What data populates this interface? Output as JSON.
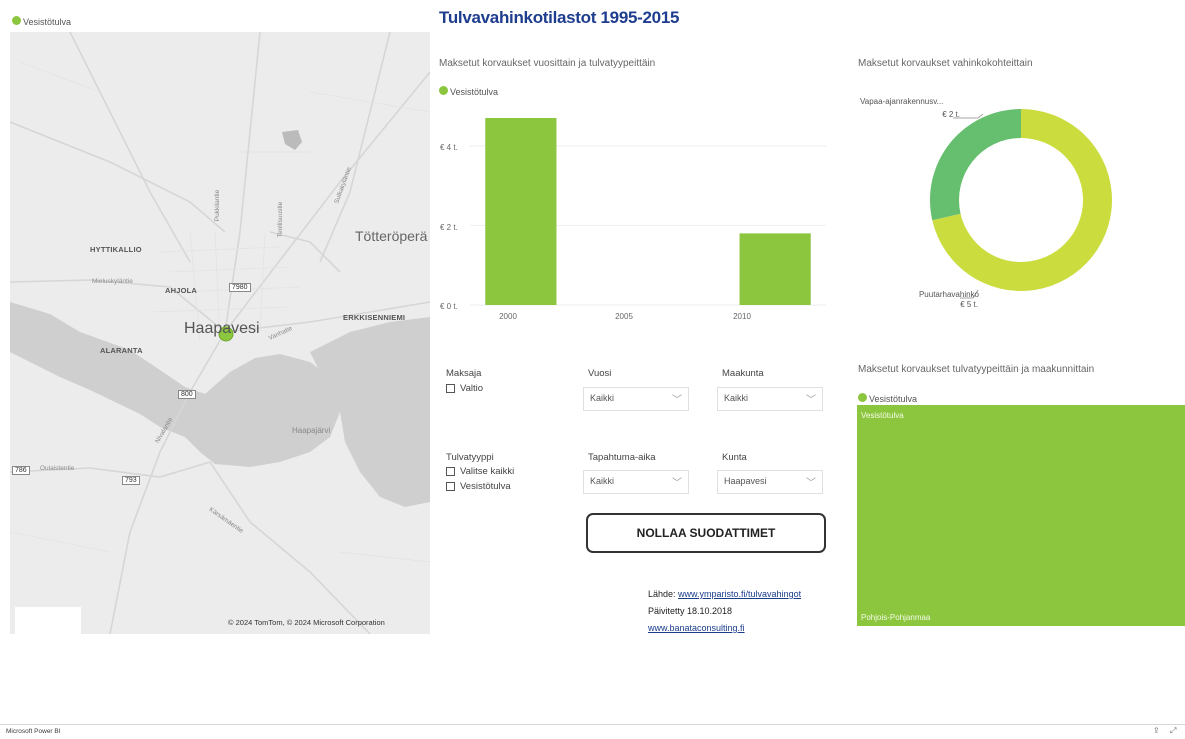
{
  "map": {
    "legend": "Vesistötulva",
    "attribution": "© 2024 TomTom, © 2024 Microsoft Corporation",
    "places": [
      "HYTTIKALLIO",
      "AHJOLA",
      "ALARANTA",
      "ERKKISENNIEMI"
    ],
    "town": "Haapavesi",
    "region": "Tötteröperä",
    "lake": "Haapajärvi",
    "roads": [
      "Mieluskyläntie",
      "Oulaistentie",
      "Pukkilantie",
      "Teollisuustie",
      "Sulkakyläntie",
      "Vanhatie",
      "Nivalantie",
      "Kärsämäentie"
    ],
    "shields": [
      "7980",
      "800",
      "786",
      "793"
    ]
  },
  "report": {
    "title": "Tulvavahinkotilastot 1995-2015"
  },
  "bar_chart": {
    "heading": "Maksetut korvaukset vuosittain ja tulvatyypeittäin",
    "legend": "Vesistötulva",
    "yticks": [
      "€ 4 t.",
      "€ 2 t.",
      "€ 0 t."
    ],
    "xticks": [
      "2000",
      "2005",
      "2010"
    ]
  },
  "donut": {
    "heading": "Maksetut korvaukset vahinkokohteittain",
    "label_top": "Vapaa-ajanrakennusv...",
    "label_top_value": "€ 2 t.",
    "label_bottom": "Puutarhavahinko",
    "label_bottom_value": "€ 5 t."
  },
  "treemap": {
    "heading": "Maksetut korvaukset tulvatyypeittäin ja maakunnittain",
    "legend": "Vesistötulva",
    "tile_label": "Vesistötulva",
    "tile_sub": "Pohjois-Pohjanmaa"
  },
  "filters": {
    "maksaja": {
      "label": "Maksaja",
      "options": [
        "Valtio"
      ]
    },
    "vuosi": {
      "label": "Vuosi",
      "value": "Kaikki"
    },
    "maakunta": {
      "label": "Maakunta",
      "value": "Kaikki"
    },
    "tulvatyyppi": {
      "label": "Tulvatyyppi",
      "options": [
        "Valitse kaikki",
        "Vesistötulva"
      ]
    },
    "tapahtuma": {
      "label": "Tapahtuma-aika",
      "value": "Kaikki"
    },
    "kunta": {
      "label": "Kunta",
      "value": "Haapavesi"
    },
    "reset": "NOLLAA SUODATTIMET"
  },
  "source": {
    "prefix": "Lähde: ",
    "link": "www.ymparisto.fi/tulvavahingot",
    "updated": "Päivitetty 18.10.2018",
    "company": "www.banataconsulting.fi"
  },
  "footer": {
    "brand": "Microsoft Power BI"
  },
  "chart_data": [
    {
      "type": "bar",
      "title": "Maksetut korvaukset vuosittain ja tulvatyypeittäin",
      "categories": [
        "2000",
        "2010"
      ],
      "series": [
        {
          "name": "Vesistötulva",
          "x": [
            2000,
            2010
          ],
          "values": [
            4.7,
            1.8
          ]
        }
      ],
      "xlabel": "",
      "ylabel": "",
      "xlim": [
        1998,
        2012
      ],
      "ylim": [
        0,
        4.7
      ],
      "yunit": "t. €",
      "color": "#8cc63f",
      "grid": true,
      "legend": "top-left"
    },
    {
      "type": "pie",
      "title": "Maksetut korvaukset vahinkokohteittain",
      "categories": [
        "Puutarhavahinko",
        "Vapaa-ajanrakennusv..."
      ],
      "values": [
        5,
        2
      ],
      "colors": [
        "#cbdc3f",
        "#66bf6e"
      ],
      "donut": true
    },
    {
      "type": "treemap",
      "title": "Maksetut korvaukset tulvatyypeittäin ja maakunnittain",
      "categories": [
        "Vesistötulva"
      ],
      "sub": [
        "Pohjois-Pohjanmaa"
      ],
      "color": "#8cc63f",
      "legend": "top-left"
    }
  ]
}
